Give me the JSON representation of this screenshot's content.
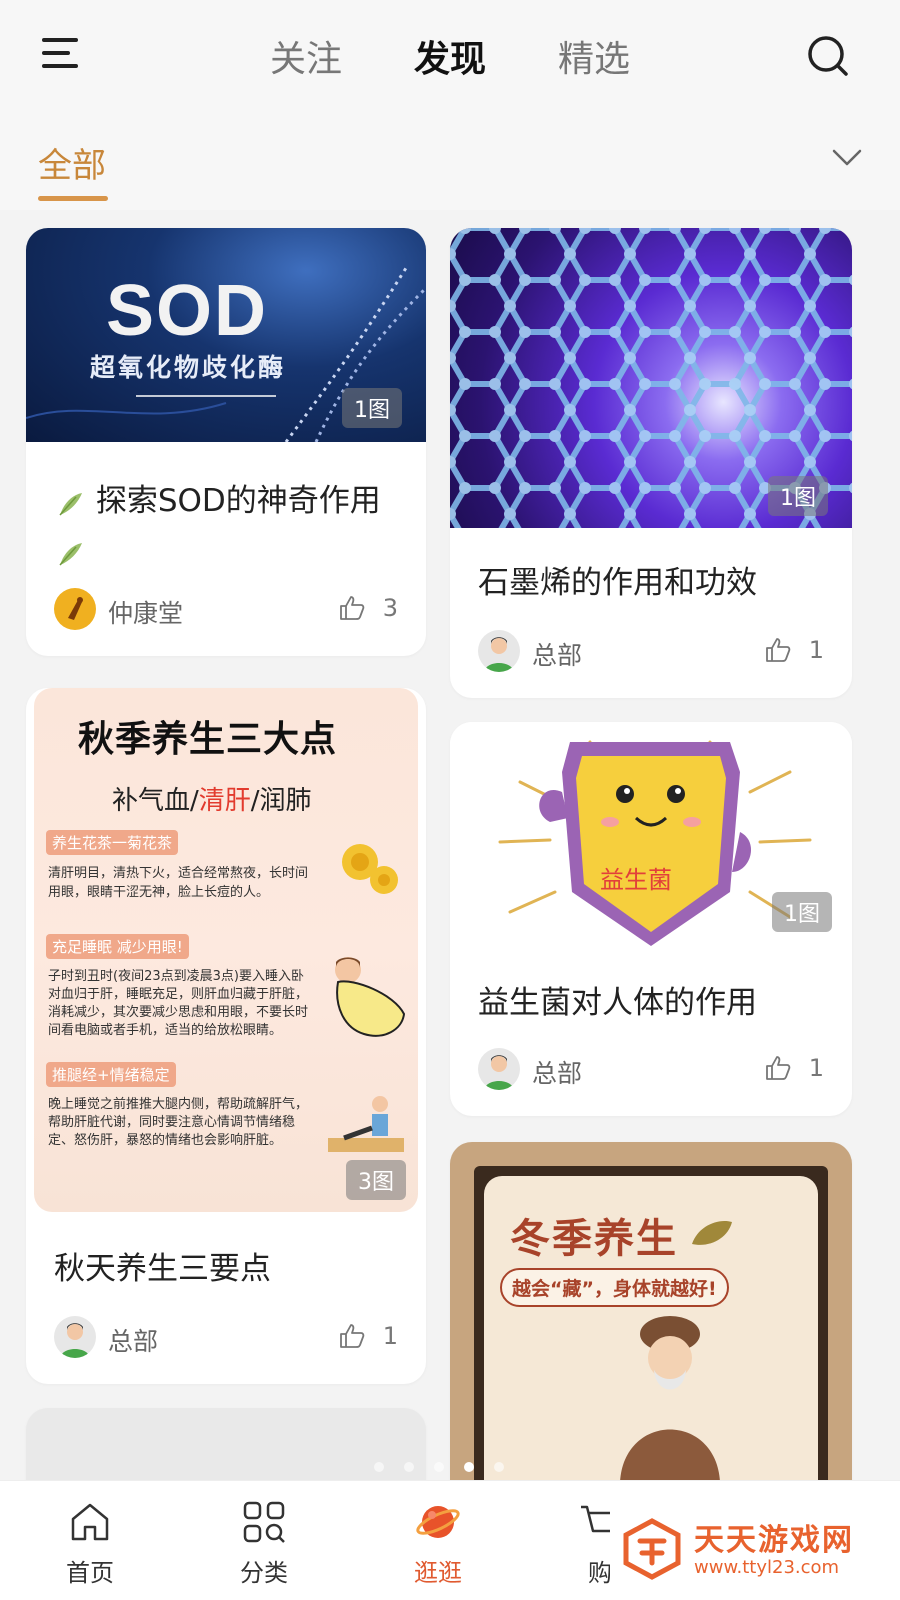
{
  "header": {
    "tabs": [
      {
        "label": "关注"
      },
      {
        "label": "发现"
      },
      {
        "label": "精选"
      }
    ],
    "active_tab": "发现"
  },
  "filter": {
    "selected": "全部"
  },
  "cards": [
    {
      "title": "探索SOD的神奇作用",
      "author": "仲康堂",
      "likes": "3",
      "badge": "1图",
      "image_text": {
        "line1": "SOD",
        "line2": "超氧化物歧化酶"
      }
    },
    {
      "title": "石墨烯的作用和功效",
      "author": "总部",
      "likes": "1",
      "badge": "1图"
    },
    {
      "title": "秋天养生三要点",
      "author": "总部",
      "likes": "1",
      "badge": "3图",
      "image_text": {
        "heading": "秋季养生三大点",
        "sub_a": "补气血/",
        "sub_b": "清肝",
        "sub_c": "/润肺",
        "sec1": "养生花茶一菊花茶",
        "p1": "清肝明目，清热下火，适合经常熬夜，长时间用眼，眼睛干涩无神，脸上长痘的人。",
        "sec2": "充足睡眠 减少用眼!",
        "p2": "子时到丑时(夜间23点到凌晨3点)要入睡入卧对血归于肝，睡眠充足，则肝血归藏于肝脏，消耗减少，其次要减少思虑和用眼，不要长时间看电脑或者手机，适当的给放松眼睛。",
        "sec3": "推腿经+情绪稳定",
        "p3": "晚上睡觉之前推推大腿内侧，帮助疏解肝气，帮助肝脏代谢，同时要注意心情调节情绪稳定、怒伤肝，暴怒的情绪也会影响肝脏。"
      }
    },
    {
      "title": "益生菌对人体的作用",
      "author": "总部",
      "likes": "1",
      "badge": "1图",
      "image_text": {
        "shield": "益生菌"
      }
    },
    {
      "image_text": {
        "title": "冬季养生",
        "sub": "越会“藏”，身体就越好!"
      }
    }
  ],
  "bottom_nav": [
    {
      "label": "首页",
      "icon": "home-icon"
    },
    {
      "label": "分类",
      "icon": "grid-icon"
    },
    {
      "label": "逛逛",
      "icon": "planet-icon"
    },
    {
      "label": "购",
      "icon": "cart-icon"
    }
  ],
  "watermark": {
    "title": "天天游戏网",
    "url": "www.ttyl23.com"
  },
  "colors": {
    "accent": "#c8873a",
    "nav_active": "#e05a30",
    "watermark": "#e8622e"
  }
}
